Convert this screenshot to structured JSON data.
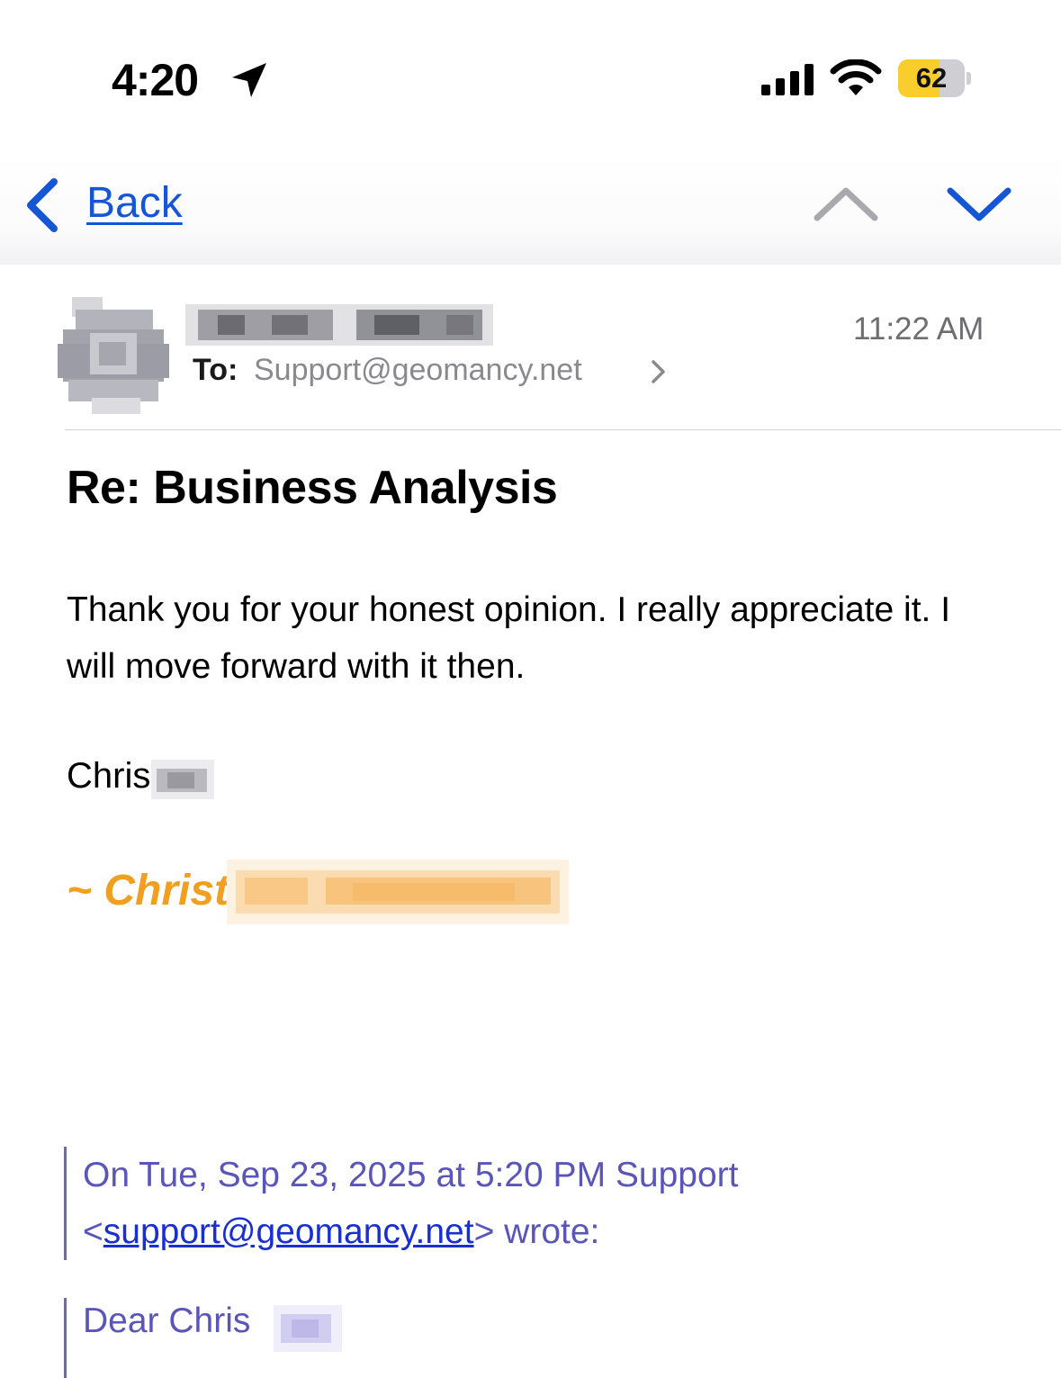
{
  "status_bar": {
    "time": "4:20",
    "battery_level": "62",
    "battery_fraction": 0.62
  },
  "nav": {
    "back_label": "Back",
    "accent_color": "#1556d6"
  },
  "message": {
    "to_label": "To:",
    "to_address": "Support@geomancy.net",
    "time": "11:22 AM",
    "subject": "Re: Business Analysis",
    "body": "Thank you for your honest opinion. I really appreciate it. I will move forward with it then.",
    "signoff_name": "Chris",
    "signature": "~ Christ"
  },
  "quoted": {
    "header_prefix": "On Tue, Sep 23, 2025 at 5:20 PM Support <",
    "header_email": "support@geomancy.net",
    "header_suffix": "> wrote:",
    "greeting": "Dear Chris",
    "color": "#5a55b8"
  }
}
